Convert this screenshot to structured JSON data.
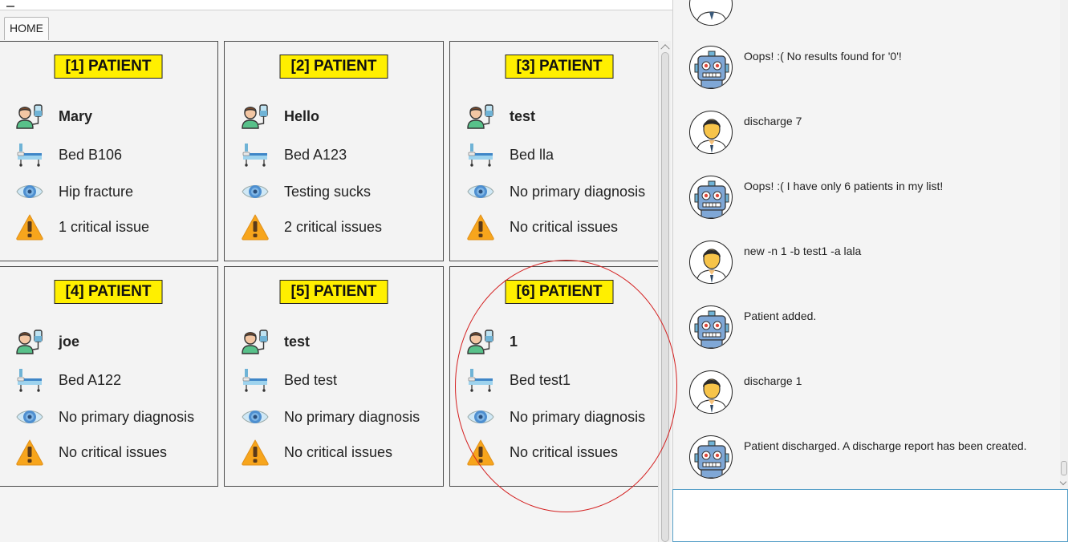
{
  "tab": {
    "label": "HOME"
  },
  "patients": [
    {
      "header": "[1] PATIENT",
      "name": "Mary",
      "bed": "Bed B106",
      "diagnosis": "Hip fracture",
      "critical": "1 critical issue"
    },
    {
      "header": "[2] PATIENT",
      "name": "Hello",
      "bed": "Bed A123",
      "diagnosis": "Testing sucks",
      "critical": "2 critical issues"
    },
    {
      "header": "[3] PATIENT",
      "name": "test",
      "bed": "Bed lla",
      "diagnosis": "No primary diagnosis",
      "critical": "No critical issues"
    },
    {
      "header": "[4] PATIENT",
      "name": "joe",
      "bed": "Bed A122",
      "diagnosis": "No primary diagnosis",
      "critical": "No critical issues"
    },
    {
      "header": "[5] PATIENT",
      "name": "test",
      "bed": "Bed test",
      "diagnosis": "No primary diagnosis",
      "critical": "No critical issues"
    },
    {
      "header": "[6] PATIENT",
      "name": "1",
      "bed": "Bed test1",
      "diagnosis": "No primary diagnosis",
      "critical": "No critical issues"
    }
  ],
  "chat": [
    {
      "sender": "bot",
      "text": "Oops! :( No results found for '0'!"
    },
    {
      "sender": "user",
      "text": "discharge 7"
    },
    {
      "sender": "bot",
      "text": "Oops! :( I have only 6 patients in my list!"
    },
    {
      "sender": "user",
      "text": "new -n 1 -b test1 -a lala"
    },
    {
      "sender": "bot",
      "text": "Patient added."
    },
    {
      "sender": "user",
      "text": "discharge 1"
    },
    {
      "sender": "bot",
      "text": "Patient discharged. A discharge report has been created."
    }
  ],
  "command_input": {
    "value": ""
  },
  "colors": {
    "header_bg": "#ffef00",
    "annotation": "#d42020",
    "input_border": "#58a0c8"
  },
  "icons": {
    "patient": "patient-iv-icon",
    "bed": "hospital-bed-icon",
    "diagnosis": "eye-icon",
    "critical": "warning-icon",
    "bot": "robot-avatar-icon",
    "user": "user-avatar-icon"
  }
}
